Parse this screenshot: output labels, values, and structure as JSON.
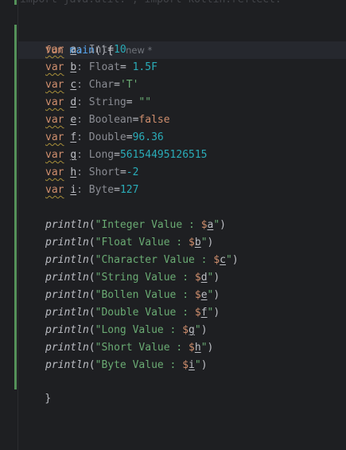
{
  "editor": {
    "faded_header": "import java.util.*; import kotlin.reflect.*",
    "fun_keyword": "fun",
    "fun_name": "main",
    "fun_open": "(){",
    "usage_hint": "new *",
    "closing_brace": "}",
    "declarations": [
      {
        "kw": "var",
        "name": "a",
        "sep": ": ",
        "type": "Int",
        "eq": "=",
        "value": "10",
        "value_kind": "num"
      },
      {
        "kw": "var",
        "name": "b",
        "sep": ": ",
        "type": "Float",
        "eq": "= ",
        "value": "1.5F",
        "value_kind": "num"
      },
      {
        "kw": "var",
        "name": "c",
        "sep": ": ",
        "type": "Char",
        "eq": "=",
        "value": "'T'",
        "value_kind": "str"
      },
      {
        "kw": "var",
        "name": "d",
        "sep": ": ",
        "type": "String",
        "eq": "= ",
        "value": "\"\"",
        "value_kind": "str"
      },
      {
        "kw": "var",
        "name": "e",
        "sep": ": ",
        "type": "Boolean",
        "eq": "=",
        "value": "false",
        "value_kind": "kw"
      },
      {
        "kw": "var",
        "name": "f",
        "sep": ": ",
        "type": "Double",
        "eq": "=",
        "value": "96.36",
        "value_kind": "num"
      },
      {
        "kw": "var",
        "name": "g",
        "sep": ": ",
        "type": "Long",
        "eq": "=",
        "value": "56154495126515",
        "value_kind": "num"
      },
      {
        "kw": "var",
        "name": "h",
        "sep": ": ",
        "type": "Short",
        "eq": "=",
        "value": "-2",
        "value_kind": "num"
      },
      {
        "kw": "var",
        "name": "i",
        "sep": ": ",
        "type": "Byte",
        "eq": "=",
        "value": "127",
        "value_kind": "num"
      }
    ],
    "prints": [
      {
        "fn": "println",
        "open": "(\"",
        "text": "Integer Value : ",
        "dollar": "$",
        "ref": "a",
        "close_q": "\"",
        "close": ")"
      },
      {
        "fn": "println",
        "open": "(\"",
        "text": "Float Value : ",
        "dollar": "$",
        "ref": "b",
        "close_q": "\"",
        "close": ")"
      },
      {
        "fn": "println",
        "open": "(\"",
        "text": "Character Value : ",
        "dollar": "$",
        "ref": "c",
        "close_q": "\"",
        "close": ")"
      },
      {
        "fn": "println",
        "open": "(\"",
        "text": "String Value : ",
        "dollar": "$",
        "ref": "d",
        "close_q": "\"",
        "close": ")"
      },
      {
        "fn": "println",
        "open": "(\"",
        "text": "Bollen Value : ",
        "dollar": "$",
        "ref": "e",
        "close_q": "\"",
        "close": ")"
      },
      {
        "fn": "println",
        "open": "(\"",
        "text": "Double Value : ",
        "dollar": "$",
        "ref": "f",
        "close_q": "\"",
        "close": ")"
      },
      {
        "fn": "println",
        "open": "(\"",
        "text": "Long Value : ",
        "dollar": "$",
        "ref": "g",
        "close_q": "\"",
        "close": ")"
      },
      {
        "fn": "println",
        "open": "(\"",
        "text": "Short Value : ",
        "dollar": "$",
        "ref": "h",
        "close_q": "\"",
        "close": ")"
      },
      {
        "fn": "println",
        "open": "(\"",
        "text": "Byte Value : ",
        "dollar": "$",
        "ref": "i",
        "close_q": "\"",
        "close": ")"
      }
    ]
  },
  "colors": {
    "background": "#1e1f22",
    "keyword": "#cf8e6d",
    "function": "#56a8f5",
    "number": "#2aacb8",
    "string": "#6aab73",
    "text": "#bcbec4",
    "change_marker": "#549159",
    "warning_underline": "#a88f39"
  }
}
